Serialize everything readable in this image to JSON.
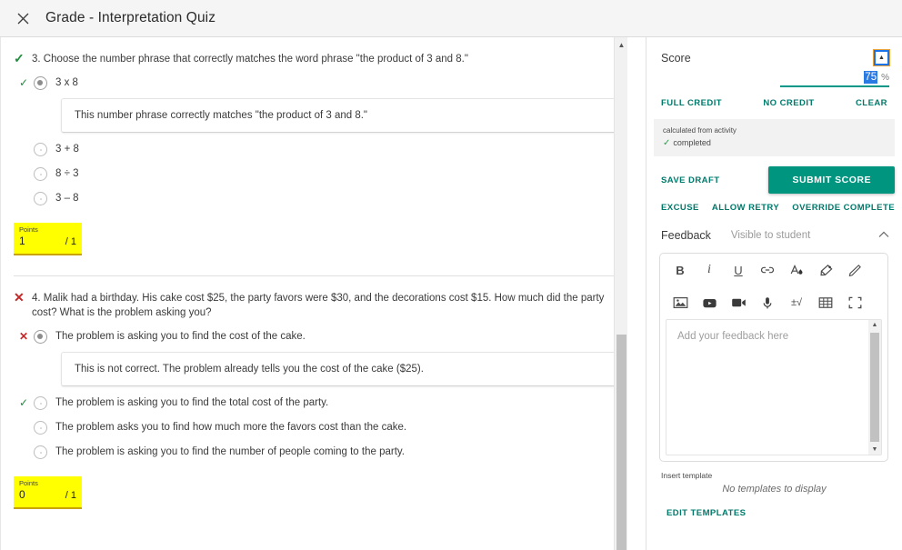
{
  "topbar": {
    "close_icon": "close-icon",
    "title": "Grade - Interpretation Quiz"
  },
  "questions": [
    {
      "number": "3.",
      "status_mark": "✓",
      "status": "correct",
      "text": "3. Choose the number phrase that correctly matches the word phrase \"the product of 3 and 8.\"",
      "options": [
        {
          "label": "3 x 8",
          "selected": true,
          "mark": "✓",
          "mark_type": "correct",
          "feedback": "This number phrase correctly matches \"the product of 3 and 8.\""
        },
        {
          "label": "3 + 8",
          "selected": false,
          "mark": "",
          "mark_type": "none",
          "feedback": ""
        },
        {
          "label": "8 ÷ 3",
          "selected": false,
          "mark": "",
          "mark_type": "none",
          "feedback": ""
        },
        {
          "label": "3 – 8",
          "selected": false,
          "mark": "",
          "mark_type": "none",
          "feedback": ""
        }
      ],
      "points_label": "Points",
      "points_value": "1",
      "points_max": "/ 1"
    },
    {
      "number": "4.",
      "status_mark": "✕",
      "status": "incorrect",
      "text": "4. Malik had a birthday. His cake cost $25, the party favors were $30, and the decorations cost $15. How much did the party cost? What is the problem asking you?",
      "options": [
        {
          "label": "The problem is asking you to find the cost of the cake.",
          "selected": true,
          "mark": "✕",
          "mark_type": "incorrect",
          "feedback": "This is not correct. The problem already tells you the cost of the cake ($25)."
        },
        {
          "label": "The problem is asking you to find the total cost of the party.",
          "selected": false,
          "mark": "✓",
          "mark_type": "correct",
          "feedback": ""
        },
        {
          "label": "The problem asks you to find how much more the favors cost than the cake.",
          "selected": false,
          "mark": "",
          "mark_type": "none",
          "feedback": ""
        },
        {
          "label": "The problem is asking you to find the number of people coming to the party.",
          "selected": false,
          "mark": "",
          "mark_type": "none",
          "feedback": ""
        }
      ],
      "points_label": "Points",
      "points_value": "0",
      "points_max": "/ 1"
    }
  ],
  "score_panel": {
    "title": "Score",
    "collapse_icon": "collapse-up-icon",
    "value": "75",
    "unit": "%",
    "full_credit_label": "FULL CREDIT",
    "no_credit_label": "NO CREDIT",
    "clear_label": "CLEAR",
    "calculated_note": "calculated from activity",
    "completed_mark": "✓",
    "completed_label": "completed",
    "save_draft_label": "SAVE DRAFT",
    "submit_score_label": "SUBMIT SCORE",
    "excuse_label": "EXCUSE",
    "allow_retry_label": "ALLOW RETRY",
    "override_complete_label": "OVERRIDE COMPLETE"
  },
  "feedback_panel": {
    "title": "Feedback",
    "visibility": "Visible to student",
    "chevron_icon": "chevron-up-icon",
    "toolbar_row1": [
      {
        "name": "bold-icon",
        "glyph": "B"
      },
      {
        "name": "italic-icon",
        "glyph": "i"
      },
      {
        "name": "underline-icon",
        "glyph": "U"
      },
      {
        "name": "link-icon",
        "glyph": "link"
      },
      {
        "name": "text-color-icon",
        "glyph": "A"
      },
      {
        "name": "highlighter-icon",
        "glyph": "marker"
      },
      {
        "name": "pencil-icon",
        "glyph": "pencil"
      }
    ],
    "toolbar_row2": [
      {
        "name": "image-icon",
        "glyph": "image"
      },
      {
        "name": "youtube-icon",
        "glyph": "youtube"
      },
      {
        "name": "video-icon",
        "glyph": "video"
      },
      {
        "name": "microphone-icon",
        "glyph": "mic"
      },
      {
        "name": "math-equation-icon",
        "glyph": "±√"
      },
      {
        "name": "table-icon",
        "glyph": "table"
      },
      {
        "name": "fullscreen-icon",
        "glyph": "fullscreen"
      }
    ],
    "placeholder": "Add your feedback here",
    "insert_template_label": "Insert template",
    "no_templates_text": "No templates to display",
    "edit_templates_label": "EDIT TEMPLATES"
  },
  "colors": {
    "teal": "#00957f",
    "teal_link": "#00796b",
    "correct_green": "#1e8e3e",
    "incorrect_red": "#c62828",
    "points_highlight": "#ffff00",
    "selection_blue": "#2a7ae4"
  }
}
